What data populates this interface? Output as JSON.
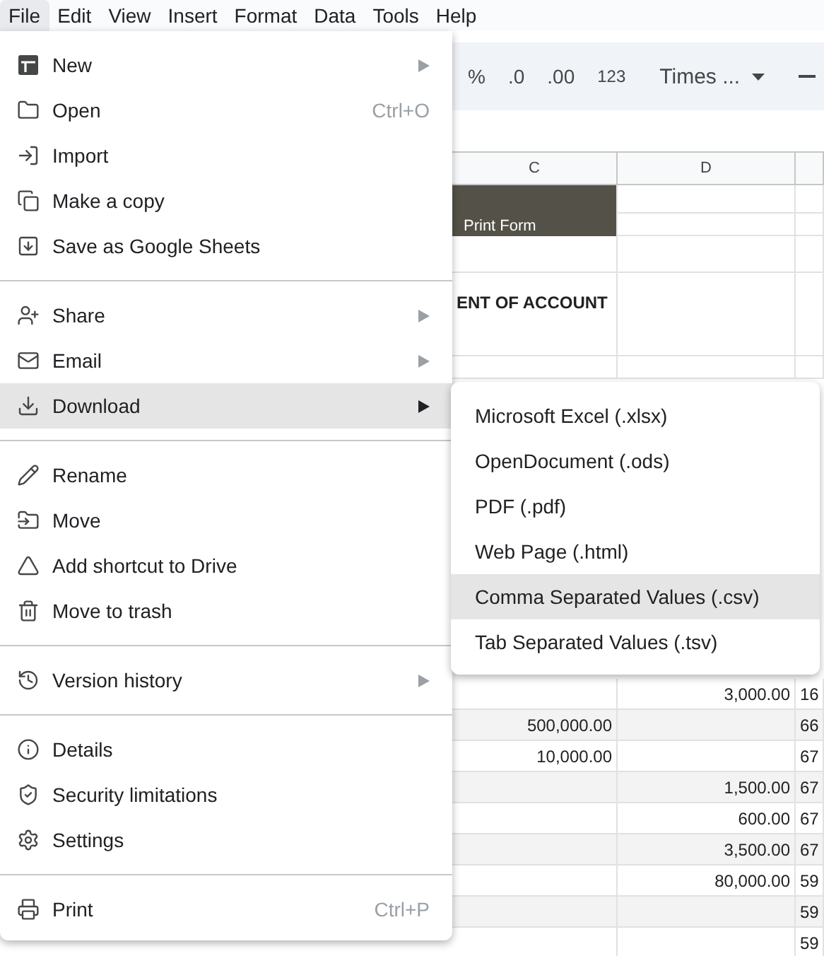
{
  "menubar": [
    {
      "label": "File",
      "selected": true
    },
    {
      "label": "Edit",
      "selected": false
    },
    {
      "label": "View",
      "selected": false
    },
    {
      "label": "Insert",
      "selected": false
    },
    {
      "label": "Format",
      "selected": false
    },
    {
      "label": "Data",
      "selected": false
    },
    {
      "label": "Tools",
      "selected": false
    },
    {
      "label": "Help",
      "selected": false
    }
  ],
  "toolbar": {
    "percent": "%",
    "decrease_decimal": ".0",
    "increase_decimal": ".00",
    "number_format": "123",
    "font": "Times ..."
  },
  "sheet": {
    "columns": [
      "C",
      "D"
    ],
    "rows": [
      {
        "kind": "band"
      },
      {
        "kind": "band",
        "c": "Print Form"
      },
      {
        "kind": "blank"
      },
      {
        "kind": "title",
        "c": "ENT OF ACCOUNT"
      },
      {
        "kind": "blank"
      },
      {
        "kind": "blank"
      },
      {
        "kind": "hidden"
      },
      {
        "kind": "data",
        "shaded": false,
        "d": "3,000.00",
        "e": "16"
      },
      {
        "kind": "data",
        "shaded": true,
        "c": "500,000.00",
        "e": "66"
      },
      {
        "kind": "data",
        "shaded": false,
        "c": "10,000.00",
        "e": "67"
      },
      {
        "kind": "data",
        "shaded": true,
        "d": "1,500.00",
        "e": "67"
      },
      {
        "kind": "data",
        "shaded": false,
        "d": "600.00",
        "e": "67"
      },
      {
        "kind": "data",
        "shaded": true,
        "d": "3,500.00",
        "e": "67"
      },
      {
        "kind": "data",
        "shaded": false,
        "d": "80,000.00",
        "e": "59"
      },
      {
        "kind": "data",
        "shaded": true,
        "e": "59"
      },
      {
        "kind": "data",
        "shaded": false,
        "e": "59"
      }
    ]
  },
  "file_menu": [
    [
      {
        "label": "New",
        "submenu": true,
        "highlighted": false
      },
      {
        "label": "Open",
        "shortcut": "Ctrl+O",
        "submenu": false,
        "highlighted": false
      },
      {
        "label": "Import",
        "submenu": false,
        "highlighted": false
      },
      {
        "label": "Make a copy",
        "submenu": false,
        "highlighted": false
      },
      {
        "label": "Save as Google Sheets",
        "submenu": false,
        "highlighted": false
      }
    ],
    [
      {
        "label": "Share",
        "submenu": true,
        "highlighted": false
      },
      {
        "label": "Email",
        "submenu": true,
        "highlighted": false
      },
      {
        "label": "Download",
        "submenu": true,
        "highlighted": true
      }
    ],
    [
      {
        "label": "Rename",
        "submenu": false,
        "highlighted": false
      },
      {
        "label": "Move",
        "submenu": false,
        "highlighted": false
      },
      {
        "label": "Add shortcut to Drive",
        "submenu": false,
        "highlighted": false
      },
      {
        "label": "Move to trash",
        "submenu": false,
        "highlighted": false
      }
    ],
    [
      {
        "label": "Version history",
        "submenu": true,
        "highlighted": false
      }
    ],
    [
      {
        "label": "Details",
        "submenu": false,
        "highlighted": false
      },
      {
        "label": "Security limitations",
        "submenu": false,
        "highlighted": false
      },
      {
        "label": "Settings",
        "submenu": false,
        "highlighted": false
      }
    ],
    [
      {
        "label": "Print",
        "shortcut": "Ctrl+P",
        "submenu": false,
        "highlighted": false
      }
    ]
  ],
  "download_menu": [
    {
      "label": "Microsoft Excel (.xlsx)",
      "selected": false
    },
    {
      "label": "OpenDocument (.ods)",
      "selected": false
    },
    {
      "label": "PDF (.pdf)",
      "selected": false
    },
    {
      "label": "Web Page (.html)",
      "selected": false
    },
    {
      "label": "Comma Separated Values (.csv)",
      "selected": true
    },
    {
      "label": "Tab Separated Values (.tsv)",
      "selected": false
    }
  ]
}
